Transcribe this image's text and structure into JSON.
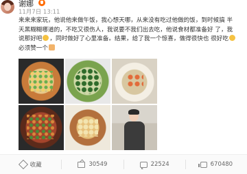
{
  "header": {
    "username": "谢娜",
    "time": "11月7日 13:11",
    "source": ""
  },
  "post": {
    "line1": "来来来家玩，他说他来做午饭，我心想天哪，从来没有吃过他做的饭，到时候搞",
    "line2": "半天黑糊糊哪道的，不吃又很伤人，我说要不我们出去吃，他说食材都准备好",
    "line3_a": "了，我说那好吧",
    "line3_b": "，同时做好了心里准备。结果，给了我一个惊喜，做得很快也",
    "line4_a": "很好吃",
    "line4_b": " 必须赞一个"
  },
  "photos": [
    {
      "name": "rice-dish-photo"
    },
    {
      "name": "cucumber-dish-photo"
    },
    {
      "name": "soup-dish-photo"
    },
    {
      "name": "chicken-dish-photo"
    },
    {
      "name": "baked-dish-photo"
    },
    {
      "name": "chef-photo"
    }
  ],
  "actions": {
    "favorite": "收藏",
    "share": "30549",
    "comment": "22524",
    "like": "670480"
  },
  "icons": {
    "favorite": "star-outline-icon",
    "share": "share-icon",
    "comment": "comment-icon",
    "like": "thumbs-up-icon"
  },
  "colors": {
    "accent": "#ff6a00",
    "text": "#333333",
    "muted": "#999999"
  }
}
